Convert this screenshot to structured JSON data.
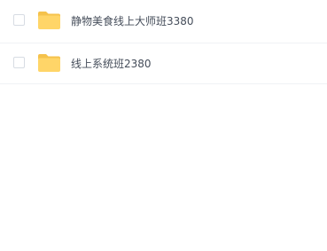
{
  "files": [
    {
      "name": "静物美食线上大师班3380",
      "icon": "folder-icon"
    },
    {
      "name": "线上系统班2380",
      "icon": "folder-icon"
    }
  ],
  "colors": {
    "folder_body": "#FFD568",
    "folder_tab": "#F5C24C",
    "text": "#454D5A",
    "divider": "#F0F2F5",
    "checkbox_border": "#D7DCE3"
  }
}
